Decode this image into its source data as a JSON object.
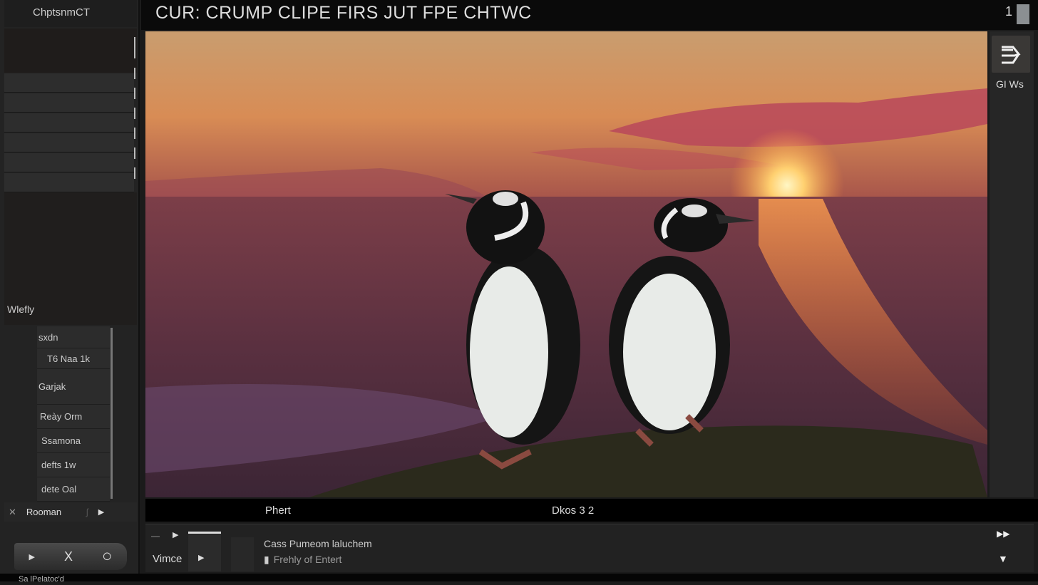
{
  "sidebar": {
    "title": "ChptsnmCT",
    "section_label": "Wlefly",
    "list_items": [
      "sxdn",
      "T6 Naa 1k",
      "Garjak",
      "Reày Orm",
      "Ssamona",
      "defts  1w",
      "dete  Oal"
    ],
    "control_row": {
      "close": "✕",
      "label": "Rooman",
      "symbol": "ʃ",
      "play": "▶"
    },
    "pill": {
      "play": "▶",
      "close": "X",
      "ring": "○"
    }
  },
  "header": {
    "title": "CUR:  CRUMP  CLIPE  FIRS  JUT  FPE  CHTWC",
    "count": "1"
  },
  "right_panel": {
    "label": "GI Ws",
    "icon": "exit-arrow-icon"
  },
  "caption_bar": {
    "left": "Phert",
    "right": "Dkos 3  2"
  },
  "bottom_controls": {
    "label": "Vimce",
    "title": "Cass Pumeom laluchem",
    "subtitle": "Frehly of Entert"
  },
  "footer": {
    "text": "Sa lPelatoc'd"
  },
  "colors": {
    "accent": "#e8e8e8",
    "sky_top": "#c79a6c",
    "sun": "#fff2b0"
  }
}
